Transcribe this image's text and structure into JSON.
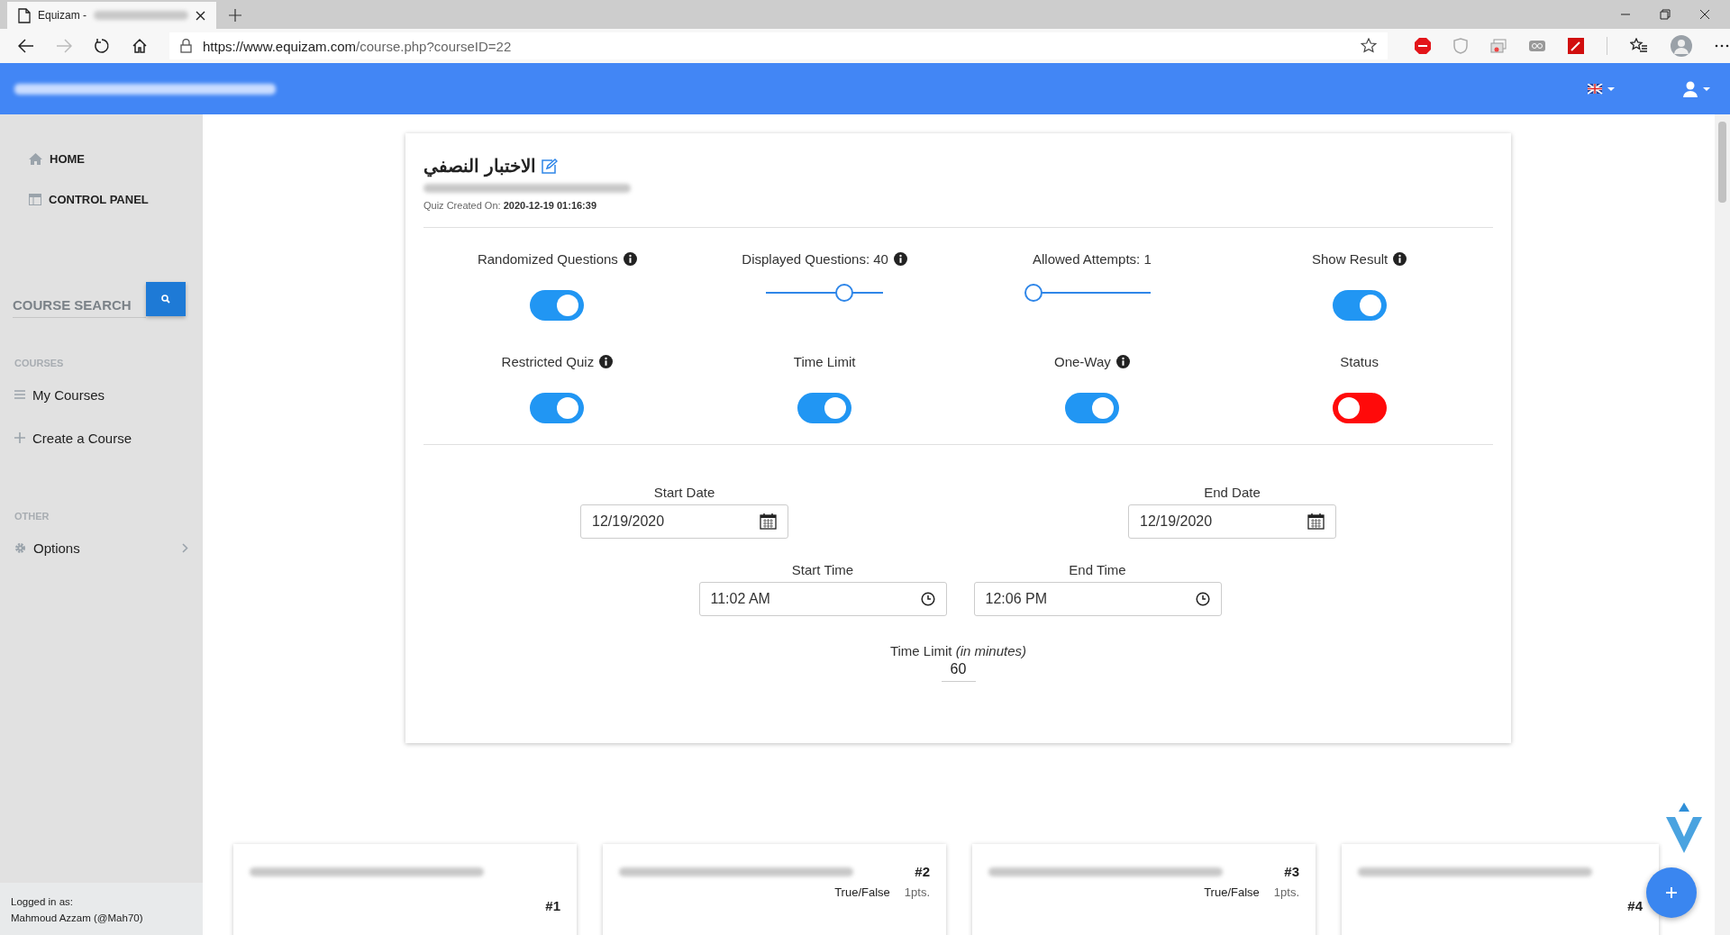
{
  "browser": {
    "tab_title": "Equizam -",
    "url_host": "https://www.equizam.com",
    "url_path": "/course.php?courseID=22",
    "forward_disabled": true
  },
  "sidebar": {
    "nav": [
      {
        "label": "HOME",
        "kind": "home"
      },
      {
        "label": "CONTROL PANEL",
        "kind": "panel"
      }
    ],
    "search": {
      "placeholder": "COURSE SEARCH"
    },
    "sections": [
      {
        "title": "COURSES",
        "items": [
          {
            "label": "My Courses",
            "kind": "list"
          },
          {
            "label": "Create a Course",
            "kind": "plus"
          }
        ]
      },
      {
        "title": "OTHER",
        "items": [
          {
            "label": "Options",
            "kind": "gear"
          }
        ]
      }
    ],
    "footer": [
      "Logged in as:",
      "Mahmoud Azzam (@Mah70)"
    ]
  },
  "quiz": {
    "title": "الاختبار النصفي",
    "created": "Quiz Created On: **2020-12-19 01:16:39**",
    "settings": [
      {
        "kind": "toggle",
        "label": "Randomized Questions",
        "info": true,
        "on": true
      },
      {
        "kind": "slider",
        "label": "Displayed Questions: 40",
        "info": true,
        "level": 0.67
      },
      {
        "kind": "slider",
        "label": "Allowed Attempts: 1",
        "info": false,
        "level": 0
      },
      {
        "kind": "toggle",
        "label": "Show Result",
        "info": true,
        "on": true
      },
      {
        "kind": "toggle",
        "label": "Restricted Quiz",
        "info": true,
        "on": true
      },
      {
        "kind": "toggle",
        "label": "Time Limit",
        "info": false,
        "on": true
      },
      {
        "kind": "toggle",
        "label": "One-Way",
        "info": true,
        "on": true
      },
      {
        "kind": "toggle",
        "label": "Status",
        "info": false,
        "on": false
      }
    ],
    "dates": [
      {
        "label": "Start Date",
        "value": "12/19/2020"
      },
      {
        "label": "End Date",
        "value": "12/19/2020"
      }
    ],
    "times": [
      {
        "label": "Start Time",
        "value": "11:02 AM"
      },
      {
        "label": "End Time",
        "value": "12:06 PM"
      }
    ],
    "time_limit": {
      "label": "Time Limit *(in minutes)*",
      "value": "60"
    }
  },
  "questions": [
    {
      "number": "#1"
    },
    {
      "number": "#2",
      "type": "True/False",
      "points": "1pts."
    },
    {
      "number": "#3",
      "type": "True/False",
      "points": "1pts."
    },
    {
      "number": "#4"
    }
  ]
}
